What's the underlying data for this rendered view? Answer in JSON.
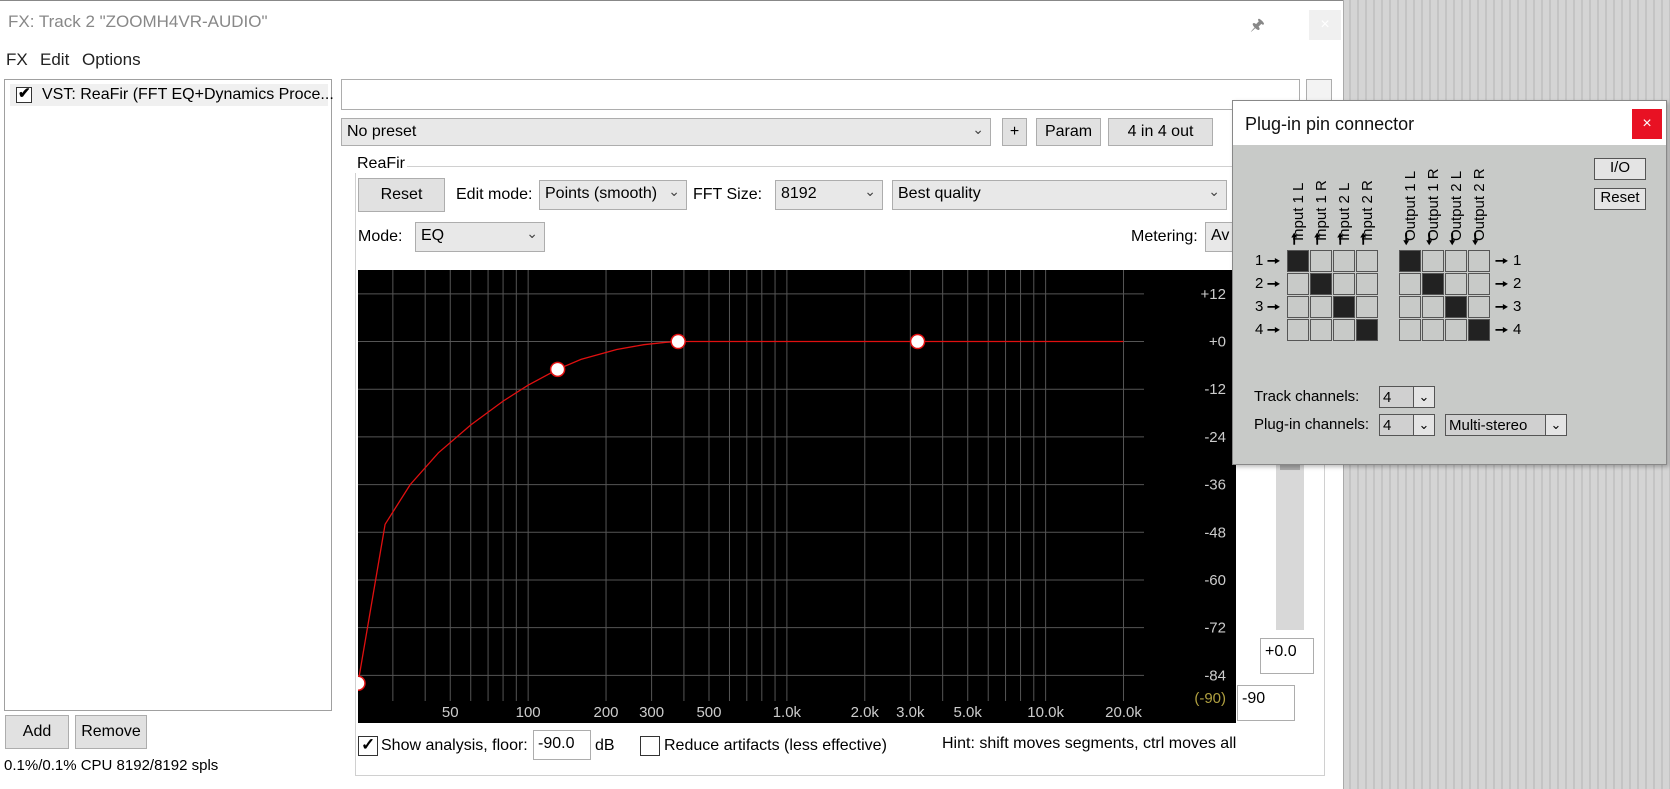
{
  "window": {
    "title": "FX: Track 2 \"ZOOMH4VR-AUDIO\"",
    "close_label": "×"
  },
  "menu": [
    "FX",
    "Edit",
    "Options"
  ],
  "fx_chain": {
    "items": [
      {
        "label": "VST: ReaFir (FFT EQ+Dynamics Proce...",
        "enabled": true
      }
    ],
    "add_label": "Add",
    "remove_label": "Remove",
    "status": "0.1%/0.1% CPU 8192/8192 spls"
  },
  "preset": {
    "value": "No preset",
    "plus_label": "+",
    "param_label": "Param",
    "io_label": "4 in 4 out"
  },
  "reafir": {
    "group_label": "ReaFir",
    "reset_label": "Reset",
    "edit_mode_label": "Edit mode:",
    "edit_mode_value": "Points (smooth)",
    "fft_size_label": "FFT Size:",
    "fft_size_value": "8192",
    "quality_value": "Best quality",
    "mode_label": "Mode:",
    "mode_value": "EQ",
    "metering_label": "Metering:",
    "metering_value": "Av",
    "show_analysis_label": "Show analysis, floor:",
    "show_analysis_checked": true,
    "floor_value": "-90.0",
    "floor_unit": "dB",
    "reduce_artifacts_label": "Reduce artifacts (less effective)",
    "reduce_artifacts_checked": false,
    "hint": "Hint: shift moves segments, ctrl moves all",
    "gain_value": "+0.0",
    "floor_box_value": "-90"
  },
  "chart_data": {
    "type": "line",
    "x_scale": "log",
    "xlim": [
      22,
      24000
    ],
    "ylim": [
      -96,
      18
    ],
    "x_ticks": [
      {
        "value": 50,
        "label": "50"
      },
      {
        "value": 100,
        "label": "100"
      },
      {
        "value": 200,
        "label": "200"
      },
      {
        "value": 300,
        "label": "300"
      },
      {
        "value": 500,
        "label": "500"
      },
      {
        "value": 1000,
        "label": "1.0k"
      },
      {
        "value": 2000,
        "label": "2.0k"
      },
      {
        "value": 3000,
        "label": "3.0k"
      },
      {
        "value": 5000,
        "label": "5.0k"
      },
      {
        "value": 10000,
        "label": "10.0k"
      },
      {
        "value": 20000,
        "label": "20.0k"
      }
    ],
    "y_ticks": [
      {
        "value": 12,
        "label": "+12"
      },
      {
        "value": 0,
        "label": "+0"
      },
      {
        "value": -12,
        "label": "-12"
      },
      {
        "value": -24,
        "label": "-24"
      },
      {
        "value": -36,
        "label": "-36"
      },
      {
        "value": -48,
        "label": "-48"
      },
      {
        "value": -60,
        "label": "-60"
      },
      {
        "value": -72,
        "label": "-72"
      },
      {
        "value": -84,
        "label": "-84"
      }
    ],
    "floor_label": "(-90)",
    "grid": true,
    "series": [
      {
        "color": "#e01010",
        "curve": [
          [
            22,
            -86
          ],
          [
            28,
            -46
          ],
          [
            35,
            -36
          ],
          [
            45,
            -28
          ],
          [
            60,
            -21
          ],
          [
            80,
            -15
          ],
          [
            100,
            -11
          ],
          [
            130,
            -7
          ],
          [
            160,
            -4.5
          ],
          [
            220,
            -2
          ],
          [
            280,
            -0.8
          ],
          [
            340,
            -0.2
          ],
          [
            380,
            0
          ],
          [
            1000,
            0
          ],
          [
            2500,
            0
          ],
          [
            3200,
            0
          ],
          [
            20000,
            0
          ]
        ],
        "points": [
          [
            22,
            -86
          ],
          [
            130,
            -7
          ],
          [
            380,
            0
          ],
          [
            3200,
            0
          ]
        ]
      }
    ],
    "colors": {
      "grid": "#555555",
      "label": "#cccccc",
      "floor": "#b0a040",
      "point_fill": "#ffffff",
      "point_stroke": "#e01010"
    }
  },
  "pin_connector": {
    "title": "Plug-in pin connector",
    "close_label": "×",
    "io_label": "I/O",
    "reset_label": "Reset",
    "inputs": [
      "Input 1 L",
      "Input 1 R",
      "Input 2 L",
      "Input 2 R"
    ],
    "outputs": [
      "Output 1 L",
      "Output 1 R",
      "Output 2 L",
      "Output 2 R"
    ],
    "rows": [
      "1",
      "2",
      "3",
      "4"
    ],
    "input_matrix_diagonal": true,
    "output_matrix_diagonal": true,
    "track_channels_label": "Track channels:",
    "track_channels_value": "4",
    "plugin_channels_label": "Plug-in channels:",
    "plugin_channels_value": "4",
    "mode_value": "Multi-stereo"
  }
}
